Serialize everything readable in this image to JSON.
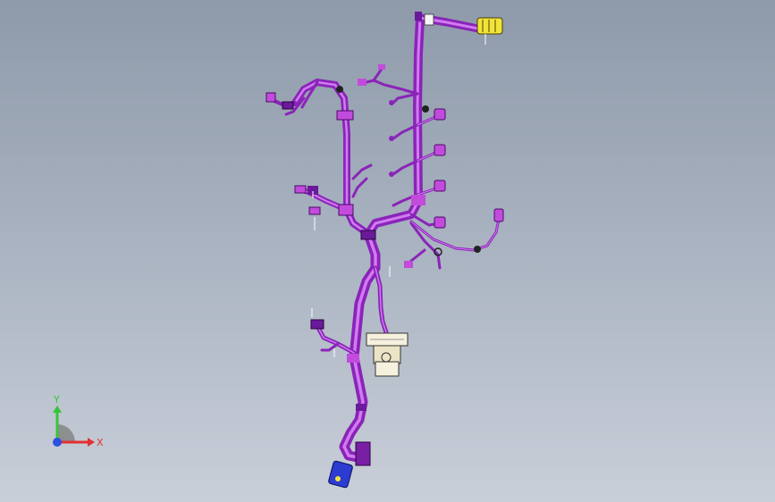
{
  "viewport": {
    "background_top": "#8e9aaa",
    "background_bottom": "#c9cfd9"
  },
  "model": {
    "harness_color": "#a52bd6",
    "harness_highlight": "#d77cf5",
    "connector_color": "#c24bdc",
    "ecu_color": "#f3ecd6",
    "yellow_connector_color": "#f2e33a",
    "blue_connector_color": "#2c3bd0"
  },
  "triad": {
    "x_label": "X",
    "y_label": "Y",
    "x_color": "#e23030",
    "y_color": "#36c53a",
    "z_color": "#2d4fe0"
  }
}
